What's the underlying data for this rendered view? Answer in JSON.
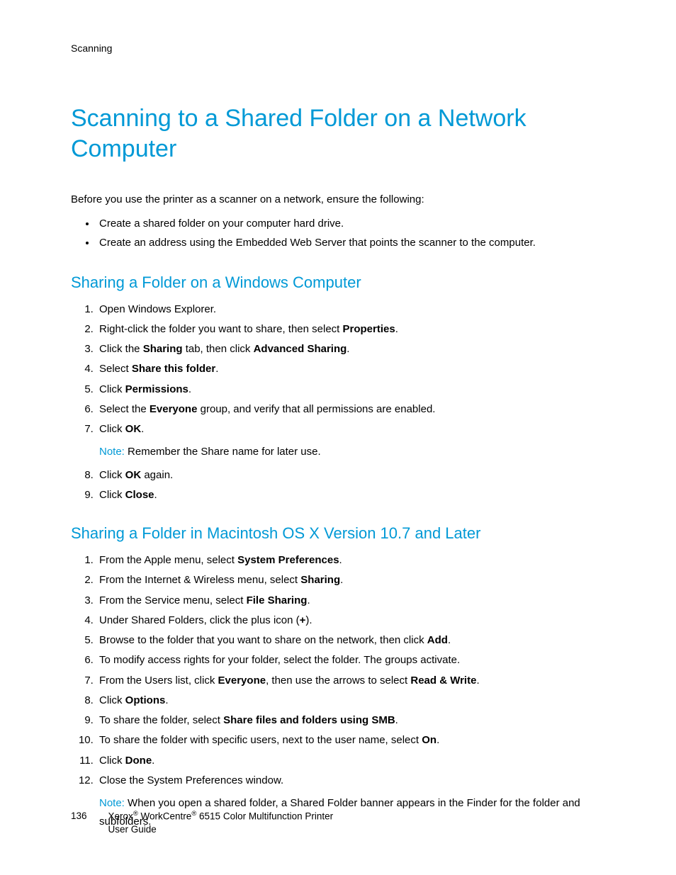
{
  "header": {
    "section": "Scanning"
  },
  "title": "Scanning to a Shared Folder on a Network Computer",
  "intro": "Before you use the printer as a scanner on a network, ensure the following:",
  "bullets": [
    "Create a shared folder on your computer hard drive.",
    "Create an address using the Embedded Web Server that points the scanner to the computer."
  ],
  "section_windows": {
    "heading": "Sharing a Folder on a Windows Computer",
    "steps": [
      {
        "text": "Open Windows Explorer."
      },
      {
        "pre": "Right-click the folder you want to share, then select ",
        "b1": "Properties",
        "post": "."
      },
      {
        "pre": "Click the ",
        "b1": "Sharing",
        "mid": " tab, then click ",
        "b2": "Advanced Sharing",
        "post": "."
      },
      {
        "pre": "Select ",
        "b1": "Share this folder",
        "post": "."
      },
      {
        "pre": "Click ",
        "b1": "Permissions",
        "post": "."
      },
      {
        "pre": "Select the ",
        "b1": "Everyone",
        "post": " group, and verify that all permissions are enabled."
      },
      {
        "pre": "Click ",
        "b1": "OK",
        "post": ".",
        "note": "Remember the Share name for later use."
      },
      {
        "pre": "Click ",
        "b1": "OK",
        "post": " again."
      },
      {
        "pre": "Click ",
        "b1": "Close",
        "post": "."
      }
    ]
  },
  "section_mac": {
    "heading": "Sharing a Folder in Macintosh OS X Version 10.7 and Later",
    "steps": [
      {
        "pre": "From the Apple menu, select ",
        "b1": "System Preferences",
        "post": "."
      },
      {
        "pre": "From the Internet & Wireless menu, select ",
        "b1": "Sharing",
        "post": "."
      },
      {
        "pre": "From the Service menu, select ",
        "b1": "File Sharing",
        "post": "."
      },
      {
        "pre": "Under Shared Folders, click the plus icon (",
        "b1": "+",
        "post": ")."
      },
      {
        "pre": "Browse to the folder that you want to share on the network, then click ",
        "b1": "Add",
        "post": "."
      },
      {
        "text": "To modify access rights for your folder, select the folder. The groups activate."
      },
      {
        "pre": "From the Users list, click ",
        "b1": "Everyone",
        "mid": ", then use the arrows to select ",
        "b2": "Read & Write",
        "post": "."
      },
      {
        "pre": "Click ",
        "b1": "Options",
        "post": "."
      },
      {
        "pre": "To share the folder, select ",
        "b1": "Share files and folders using SMB",
        "post": "."
      },
      {
        "pre": "To share the folder with specific users, next to the user name, select ",
        "b1": "On",
        "post": "."
      },
      {
        "pre": "Click ",
        "b1": "Done",
        "post": "."
      },
      {
        "text": "Close the System Preferences window.",
        "note": "When you open a shared folder, a Shared Folder banner appears in the Finder for the folder and subfolders."
      }
    ]
  },
  "note_label": "Note:",
  "footer": {
    "page_number": "136",
    "line1_pre": "Xerox",
    "line1_mid": " WorkCentre",
    "line1_post": " 6515 Color Multifunction Printer",
    "line2": "User Guide",
    "reg": "®"
  }
}
